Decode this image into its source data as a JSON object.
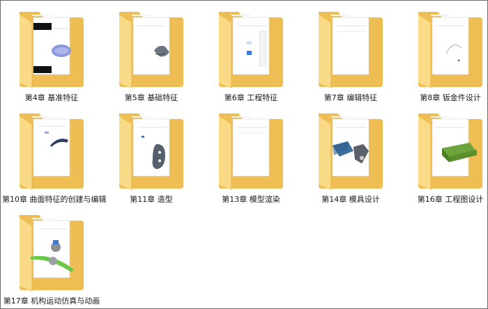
{
  "folders": [
    {
      "name": "第4章 基准特征",
      "icon": "folder-icon",
      "preview": "datum"
    },
    {
      "name": "第5章 基础特征",
      "icon": "folder-icon",
      "preview": "base"
    },
    {
      "name": "第6章 工程特征",
      "icon": "folder-icon",
      "preview": "engineering"
    },
    {
      "name": "第7章 编辑特征",
      "icon": "folder-icon",
      "preview": "blank"
    },
    {
      "name": "第8章 钣金件设计",
      "icon": "folder-icon",
      "preview": "sheetmetal"
    },
    {
      "name": "第10章 曲面特征的创建与编辑",
      "icon": "folder-icon",
      "preview": "surface"
    },
    {
      "name": "第11章 造型",
      "icon": "folder-icon",
      "preview": "style"
    },
    {
      "name": "第13章 模型渲染",
      "icon": "folder-icon",
      "preview": "blank"
    },
    {
      "name": "第14章 模具设计",
      "icon": "folder-icon",
      "preview": "mold"
    },
    {
      "name": "第16章 工程图设计",
      "icon": "folder-icon",
      "preview": "drawing"
    },
    {
      "name": "第17章 机构运动仿真与动画",
      "icon": "folder-icon",
      "preview": "mechanism"
    }
  ],
  "colors": {
    "folder_back": "#eebe54",
    "folder_front": "#f9da86",
    "folder_edge": "#e4ac3e",
    "paper": "#ffffff",
    "label": "#1a1a1a"
  }
}
